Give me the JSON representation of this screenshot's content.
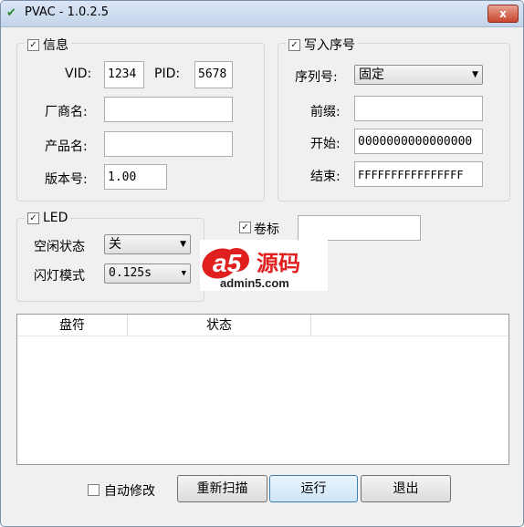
{
  "window": {
    "title": "PVAC - 1.0.2.5",
    "close_label": "x"
  },
  "info_group": {
    "legend": "信息",
    "checked": true,
    "vid_label": "VID:",
    "vid_value": "1234",
    "pid_label": "PID:",
    "pid_value": "5678",
    "vendor_label": "厂商名:",
    "vendor_value": "",
    "product_label": "产品名:",
    "product_value": "",
    "version_label": "版本号:",
    "version_value": "1.00"
  },
  "serial_group": {
    "legend": "写入序号",
    "checked": true,
    "serial_label": "序列号:",
    "serial_value": "固定",
    "prefix_label": "前缀:",
    "prefix_value": "",
    "start_label": "开始:",
    "start_value": "0000000000000000",
    "end_label": "结束:",
    "end_value": "FFFFFFFFFFFFFFFF"
  },
  "led_group": {
    "legend": "LED",
    "checked": true,
    "idle_label": "空闲状态",
    "idle_value": "关",
    "blink_label": "闪灯模式",
    "blink_value": "0.125s"
  },
  "volume": {
    "label": "卷标",
    "checked": true,
    "value": ""
  },
  "watermark": {
    "brand": "a5源码",
    "site": "admin5.com"
  },
  "table": {
    "columns": [
      "盘符",
      "状态"
    ]
  },
  "footer": {
    "auto_modify_label": "自动修改",
    "auto_modify_checked": false,
    "rescan_label": "重新扫描",
    "run_label": "运行",
    "exit_label": "退出"
  }
}
